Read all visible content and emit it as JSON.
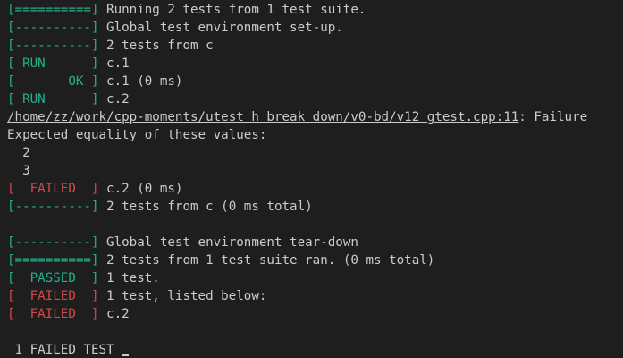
{
  "terminal": {
    "lines": [
      {
        "tag": "[==========]",
        "tag_color": "green",
        "text": " Running 2 tests from 1 test suite."
      },
      {
        "tag": "[----------]",
        "tag_color": "green",
        "text": " Global test environment set-up."
      },
      {
        "tag": "[----------]",
        "tag_color": "green",
        "text": " 2 tests from c"
      },
      {
        "tag": "[ RUN      ]",
        "tag_color": "green",
        "text": " c.1"
      },
      {
        "tag": "[       OK ]",
        "tag_color": "green",
        "text": " c.1 (0 ms)"
      },
      {
        "tag": "[ RUN      ]",
        "tag_color": "green",
        "text": " c.2"
      },
      {
        "link": "/home/zz/work/cpp-moments/utest_h_break_down/v0-bd/v12_gtest.cpp:11",
        "text": ": Failure"
      },
      {
        "text": "Expected equality of these values:"
      },
      {
        "text": "  2"
      },
      {
        "text": "  3"
      },
      {
        "tag": "[  FAILED  ]",
        "tag_color": "red",
        "text": " c.2 (0 ms)"
      },
      {
        "tag": "[----------]",
        "tag_color": "green",
        "text": " 2 tests from c (0 ms total)"
      },
      {
        "text": ""
      },
      {
        "tag": "[----------]",
        "tag_color": "green",
        "text": " Global test environment tear-down"
      },
      {
        "tag": "[==========]",
        "tag_color": "green",
        "text": " 2 tests from 1 test suite ran. (0 ms total)"
      },
      {
        "tag": "[  PASSED  ]",
        "tag_color": "green",
        "text": " 1 test."
      },
      {
        "tag": "[  FAILED  ]",
        "tag_color": "red",
        "text": " 1 test, listed below:"
      },
      {
        "tag": "[  FAILED  ]",
        "tag_color": "red",
        "text": " c.2"
      },
      {
        "text": ""
      },
      {
        "text": " 1 FAILED TEST",
        "cursor": true
      }
    ]
  },
  "colors": {
    "background": "#1e1e1e",
    "foreground": "#cccccc",
    "green": "#23b08d",
    "red": "#cd4b4b"
  }
}
